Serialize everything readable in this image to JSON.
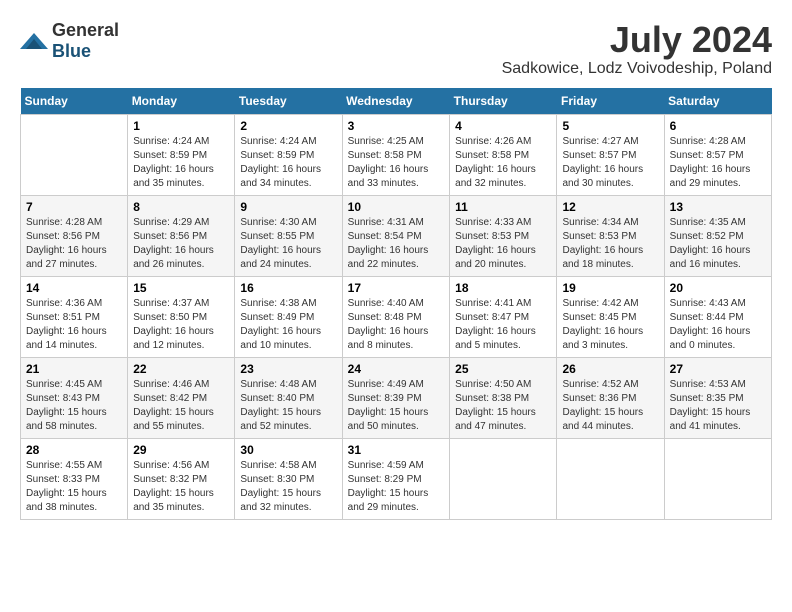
{
  "logo": {
    "general": "General",
    "blue": "Blue"
  },
  "title": {
    "month_year": "July 2024",
    "location": "Sadkowice, Lodz Voivodeship, Poland"
  },
  "headers": [
    "Sunday",
    "Monday",
    "Tuesday",
    "Wednesday",
    "Thursday",
    "Friday",
    "Saturday"
  ],
  "weeks": [
    [
      {
        "day": "",
        "info": ""
      },
      {
        "day": "1",
        "info": "Sunrise: 4:24 AM\nSunset: 8:59 PM\nDaylight: 16 hours\nand 35 minutes."
      },
      {
        "day": "2",
        "info": "Sunrise: 4:24 AM\nSunset: 8:59 PM\nDaylight: 16 hours\nand 34 minutes."
      },
      {
        "day": "3",
        "info": "Sunrise: 4:25 AM\nSunset: 8:58 PM\nDaylight: 16 hours\nand 33 minutes."
      },
      {
        "day": "4",
        "info": "Sunrise: 4:26 AM\nSunset: 8:58 PM\nDaylight: 16 hours\nand 32 minutes."
      },
      {
        "day": "5",
        "info": "Sunrise: 4:27 AM\nSunset: 8:57 PM\nDaylight: 16 hours\nand 30 minutes."
      },
      {
        "day": "6",
        "info": "Sunrise: 4:28 AM\nSunset: 8:57 PM\nDaylight: 16 hours\nand 29 minutes."
      }
    ],
    [
      {
        "day": "7",
        "info": "Sunrise: 4:28 AM\nSunset: 8:56 PM\nDaylight: 16 hours\nand 27 minutes."
      },
      {
        "day": "8",
        "info": "Sunrise: 4:29 AM\nSunset: 8:56 PM\nDaylight: 16 hours\nand 26 minutes."
      },
      {
        "day": "9",
        "info": "Sunrise: 4:30 AM\nSunset: 8:55 PM\nDaylight: 16 hours\nand 24 minutes."
      },
      {
        "day": "10",
        "info": "Sunrise: 4:31 AM\nSunset: 8:54 PM\nDaylight: 16 hours\nand 22 minutes."
      },
      {
        "day": "11",
        "info": "Sunrise: 4:33 AM\nSunset: 8:53 PM\nDaylight: 16 hours\nand 20 minutes."
      },
      {
        "day": "12",
        "info": "Sunrise: 4:34 AM\nSunset: 8:53 PM\nDaylight: 16 hours\nand 18 minutes."
      },
      {
        "day": "13",
        "info": "Sunrise: 4:35 AM\nSunset: 8:52 PM\nDaylight: 16 hours\nand 16 minutes."
      }
    ],
    [
      {
        "day": "14",
        "info": "Sunrise: 4:36 AM\nSunset: 8:51 PM\nDaylight: 16 hours\nand 14 minutes."
      },
      {
        "day": "15",
        "info": "Sunrise: 4:37 AM\nSunset: 8:50 PM\nDaylight: 16 hours\nand 12 minutes."
      },
      {
        "day": "16",
        "info": "Sunrise: 4:38 AM\nSunset: 8:49 PM\nDaylight: 16 hours\nand 10 minutes."
      },
      {
        "day": "17",
        "info": "Sunrise: 4:40 AM\nSunset: 8:48 PM\nDaylight: 16 hours\nand 8 minutes."
      },
      {
        "day": "18",
        "info": "Sunrise: 4:41 AM\nSunset: 8:47 PM\nDaylight: 16 hours\nand 5 minutes."
      },
      {
        "day": "19",
        "info": "Sunrise: 4:42 AM\nSunset: 8:45 PM\nDaylight: 16 hours\nand 3 minutes."
      },
      {
        "day": "20",
        "info": "Sunrise: 4:43 AM\nSunset: 8:44 PM\nDaylight: 16 hours\nand 0 minutes."
      }
    ],
    [
      {
        "day": "21",
        "info": "Sunrise: 4:45 AM\nSunset: 8:43 PM\nDaylight: 15 hours\nand 58 minutes."
      },
      {
        "day": "22",
        "info": "Sunrise: 4:46 AM\nSunset: 8:42 PM\nDaylight: 15 hours\nand 55 minutes."
      },
      {
        "day": "23",
        "info": "Sunrise: 4:48 AM\nSunset: 8:40 PM\nDaylight: 15 hours\nand 52 minutes."
      },
      {
        "day": "24",
        "info": "Sunrise: 4:49 AM\nSunset: 8:39 PM\nDaylight: 15 hours\nand 50 minutes."
      },
      {
        "day": "25",
        "info": "Sunrise: 4:50 AM\nSunset: 8:38 PM\nDaylight: 15 hours\nand 47 minutes."
      },
      {
        "day": "26",
        "info": "Sunrise: 4:52 AM\nSunset: 8:36 PM\nDaylight: 15 hours\nand 44 minutes."
      },
      {
        "day": "27",
        "info": "Sunrise: 4:53 AM\nSunset: 8:35 PM\nDaylight: 15 hours\nand 41 minutes."
      }
    ],
    [
      {
        "day": "28",
        "info": "Sunrise: 4:55 AM\nSunset: 8:33 PM\nDaylight: 15 hours\nand 38 minutes."
      },
      {
        "day": "29",
        "info": "Sunrise: 4:56 AM\nSunset: 8:32 PM\nDaylight: 15 hours\nand 35 minutes."
      },
      {
        "day": "30",
        "info": "Sunrise: 4:58 AM\nSunset: 8:30 PM\nDaylight: 15 hours\nand 32 minutes."
      },
      {
        "day": "31",
        "info": "Sunrise: 4:59 AM\nSunset: 8:29 PM\nDaylight: 15 hours\nand 29 minutes."
      },
      {
        "day": "",
        "info": ""
      },
      {
        "day": "",
        "info": ""
      },
      {
        "day": "",
        "info": ""
      }
    ]
  ]
}
